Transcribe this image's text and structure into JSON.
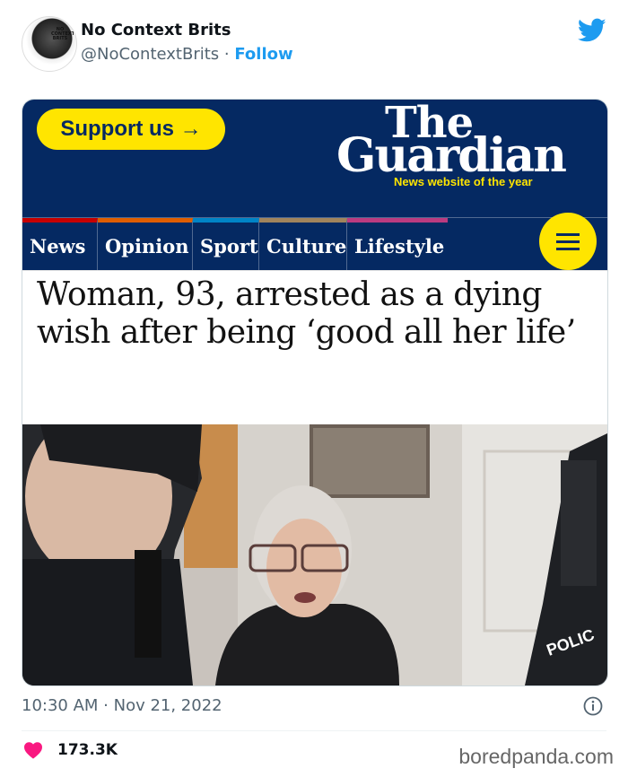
{
  "tweet": {
    "avatar_text": "NO CONTEXT BRITS",
    "display_name": "No Context Brits",
    "handle": "@NoContextBrits",
    "separator": " · ",
    "follow_label": "Follow",
    "timestamp": "10:30 AM · Nov 21, 2022",
    "likes": "173.3K",
    "like_color": "#f91880",
    "icons": [
      "twitter-bird-icon",
      "info-icon",
      "heart-icon"
    ]
  },
  "guardian": {
    "support_label": "Support us →",
    "logo_line1": "The",
    "logo_line2": "Guardian",
    "tagline": "News website of the year",
    "brand_color": "#052962",
    "accent_color": "#ffe500",
    "nav": [
      {
        "label": "News",
        "color": "#c70000"
      },
      {
        "label": "Opinion",
        "color": "#e05e00"
      },
      {
        "label": "Sport",
        "color": "#0084c6"
      },
      {
        "label": "Culture",
        "color": "#a1845c"
      },
      {
        "label": "Lifestyle",
        "color": "#bb3b80"
      }
    ],
    "headline": "Woman, 93, arrested as a dying wish after being ‘good all her life’"
  },
  "watermark": "boredpanda.com"
}
